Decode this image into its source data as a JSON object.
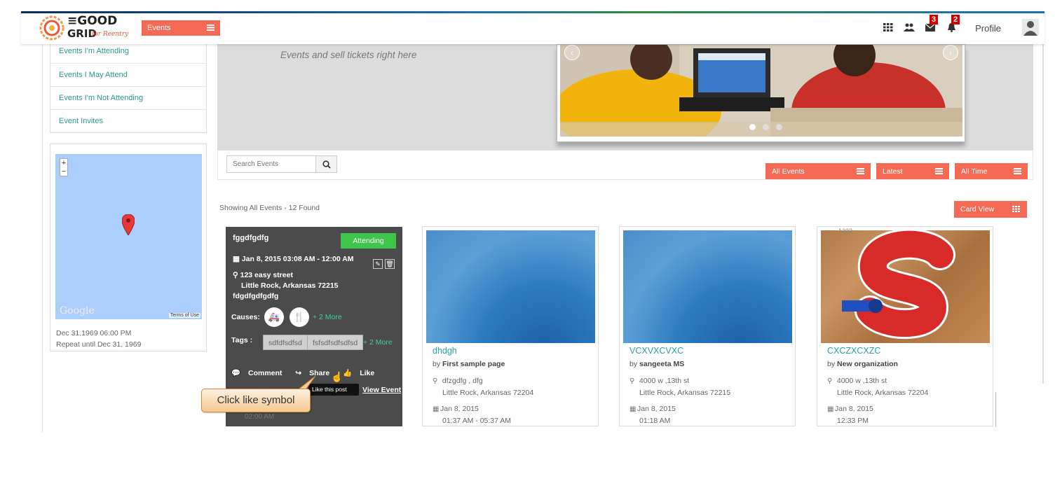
{
  "header": {
    "logo_line1": "≡GOOD",
    "logo_line2": "GRID",
    "logo_tagline": "for Reentry",
    "events_button": "Events",
    "messages_badge": "3",
    "notifications_badge": "2",
    "profile_label": "Profile"
  },
  "sidebar": {
    "menu": [
      "Events I'm Attending",
      "Events I May Attend",
      "Events I'm Not Attending",
      "Event Invites"
    ],
    "map": {
      "zoom_in": "+",
      "zoom_out": "−",
      "google_label": "Google",
      "terms_label": "Terms of Use"
    },
    "event_date": "Dec 31,1969 06:00 PM",
    "repeat_text": "Repeat until Dec 31, 1969"
  },
  "banner": {
    "text": "Events and sell tickets right here"
  },
  "filters": {
    "search_placeholder": "Search Events",
    "all_events": "All Events",
    "latest": "Latest",
    "all_time": "All Time"
  },
  "results": {
    "showing_text": "Showing All Events - 12 Found",
    "view_button": "Card View"
  },
  "featured_card": {
    "title": "fggdfgdfg",
    "status": "Attending",
    "datetime": "Jan 8, 2015 03:08 AM - 12:00 AM",
    "address_line1": "123 easy street",
    "address_line2": "Little Rock, Arkansas 72215",
    "description": "fdgdfgdfgdfg",
    "causes_label": "Causes:",
    "causes_more": "+ 2 More",
    "tags_label": "Tags :",
    "tags": [
      "sdfdfsdfsd",
      "fsfsdfsdfsdfsd"
    ],
    "tags_more": "+ 2 More",
    "comment_label": "Comment",
    "share_label": "Share",
    "like_label": "Like",
    "tooltip": "Like this post",
    "view_event": "View Event",
    "ghost_time": "02:00 AM"
  },
  "callout": {
    "text": "Click like symbol"
  },
  "cards": [
    {
      "name": "dhdgh",
      "by_prefix": "by ",
      "organizer": "First sample page",
      "address_line1": "dfzgdfg , dfg",
      "address_line2": "Little Rock, Arkansas 72204",
      "date": "Jan 8, 2015",
      "time": "01:37 AM - 05:37 AM"
    },
    {
      "name": "VCXVXCVXC",
      "by_prefix": "by ",
      "organizer": "sangeeta MS",
      "address_line1": "4000 w ,13th st",
      "address_line2": "Little Rock, Arkansas 72215",
      "date": "Jan 8, 2015",
      "time": "01:18 AM"
    },
    {
      "name": "CXCZXCXZC",
      "by_prefix": "by ",
      "organizer": "New organization",
      "address_line1": "4000 w ,13th st",
      "address_line2": "Little Rock, Arkansas 72204",
      "date": "Jan 8, 2015",
      "time": "12:33 PM",
      "overlay_number": "1222"
    }
  ],
  "colors": {
    "accent": "#f56a55",
    "attending_green": "#3ec64a",
    "link_teal": "#2aa2a0",
    "badge_red": "#d40000"
  }
}
